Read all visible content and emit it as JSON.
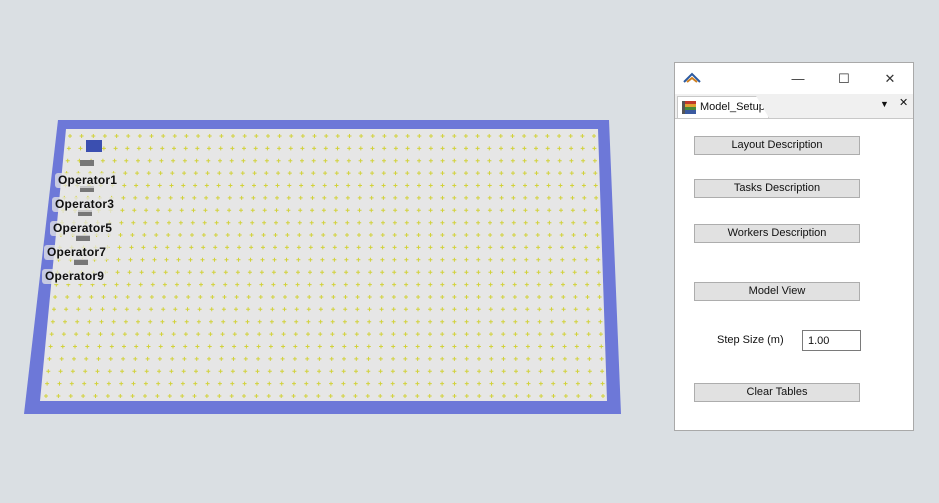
{
  "viewport": {
    "floor_color": "#e6e6e6",
    "border_color": "#6d78d8",
    "grid_mark_color": "#d2d23a",
    "operators": [
      "Operator1",
      "Operator3",
      "Operator5",
      "Operator7",
      "Operator9"
    ]
  },
  "window": {
    "title_icon": "app-logo-icon",
    "minimize_glyph": "—",
    "maximize_glyph": "☐",
    "close_glyph": "✕",
    "tab_label": "Model_Setup",
    "tab_dropdown_glyph": "▼",
    "tab_close_glyph": "✕",
    "buttons": {
      "layout": "Layout Description",
      "tasks": "Tasks Description",
      "workers": "Workers Description",
      "model_view": "Model View",
      "clear_tables": "Clear Tables"
    },
    "step_size_label": "Step Size (m)",
    "step_size_value": "1.00"
  }
}
